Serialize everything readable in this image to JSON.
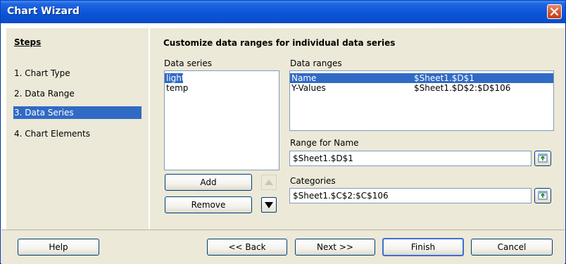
{
  "window": {
    "title": "Chart Wizard"
  },
  "steps": {
    "heading": "Steps",
    "items": [
      {
        "label": "1. Chart Type"
      },
      {
        "label": "2. Data Range"
      },
      {
        "label": "3. Data Series",
        "selected": true
      },
      {
        "label": "4. Chart Elements"
      }
    ]
  },
  "main": {
    "heading": "Customize data ranges for individual data series",
    "data_series": {
      "label": "Data series",
      "items": [
        {
          "name": "light",
          "selected": true
        },
        {
          "name": "temp"
        }
      ]
    },
    "data_ranges": {
      "label": "Data ranges",
      "rows": [
        {
          "role": "Name",
          "range": "$Sheet1.$D$1",
          "selected": true
        },
        {
          "role": "Y-Values",
          "range": "$Sheet1.$D$2:$D$106"
        }
      ]
    },
    "range_for_name": {
      "label": "Range for Name",
      "value": "$Sheet1.$D$1"
    },
    "categories": {
      "label": "Categories",
      "value": "$Sheet1.$C$2:$C$106"
    },
    "buttons": {
      "add": "Add",
      "remove": "Remove"
    }
  },
  "footer": {
    "help": "Help",
    "back": "<< Back",
    "next": "Next >>",
    "finish": "Finish",
    "cancel": "Cancel"
  },
  "colors": {
    "titlebar": "#0a53d8",
    "selection": "#316ac5",
    "dialog_bg": "#ece9d8",
    "close_button": "#d2522c"
  }
}
